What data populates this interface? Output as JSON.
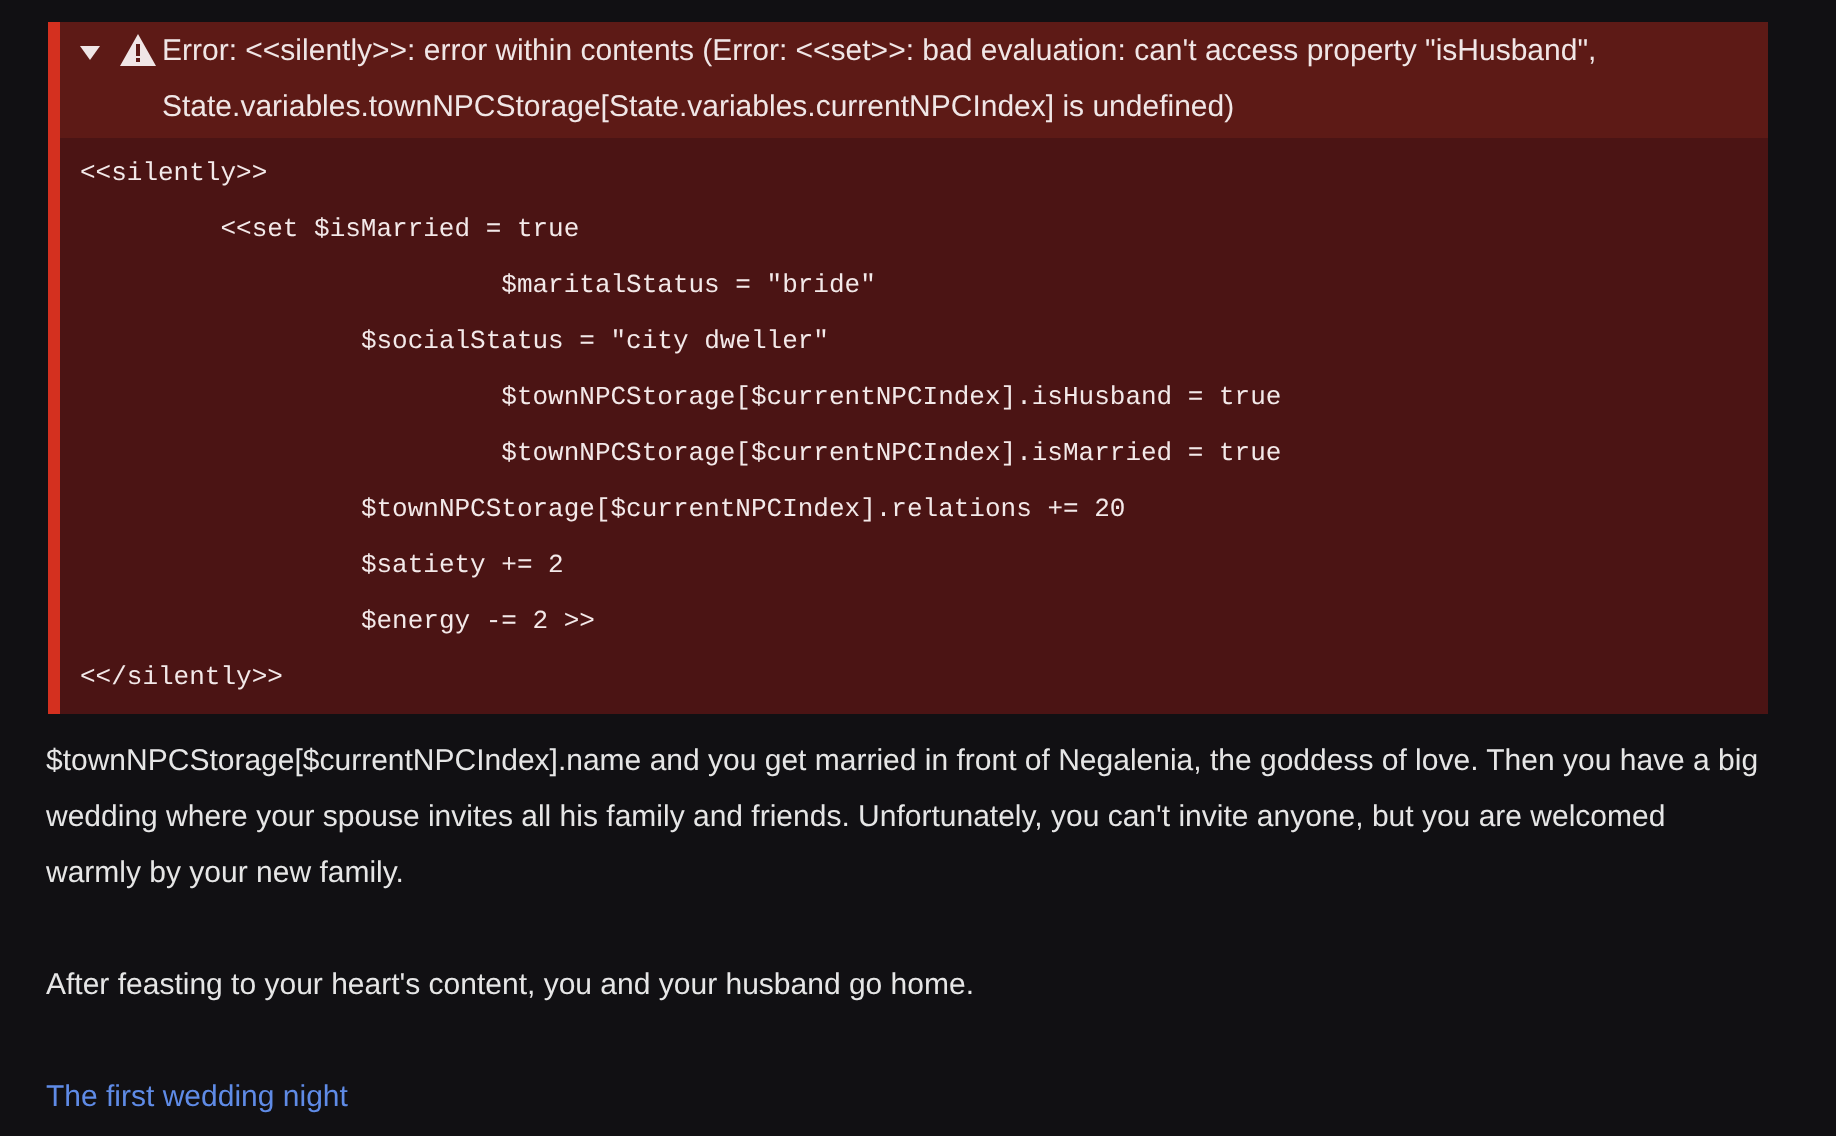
{
  "error": {
    "expanded": true,
    "message": "Error: <<silently>>: error within contents (Error: <<set>>: bad evaluation: can't access property \"isHusband\", State.variables.townNPCStorage[State.variables.currentNPCIndex] is undefined)",
    "code_lines": [
      "<<silently>>",
      "\t<<set $isMarried = true",
      "\t\t\t$maritalStatus = \"bride\"",
      "\t\t$socialStatus = \"city dweller\"",
      "\t\t\t$townNPCStorage[$currentNPCIndex].isHusband = true",
      "\t\t\t$townNPCStorage[$currentNPCIndex].isMarried = true",
      "\t\t$townNPCStorage[$currentNPCIndex].relations += 20",
      "\t\t$satiety += 2",
      "\t\t$energy -= 2 >>",
      "<</silently>>"
    ]
  },
  "paragraphs": [
    "$townNPCStorage[$currentNPCIndex].name and you get married in front of Negalenia, the goddess of love. Then you have a big wedding where your spouse invites all his family and friends. Unfortunately, you can't invite anyone, but you are welcomed warmly by your new family.",
    "After feasting to your heart's content, you and your husband go home."
  ],
  "link": "The first wedding night"
}
